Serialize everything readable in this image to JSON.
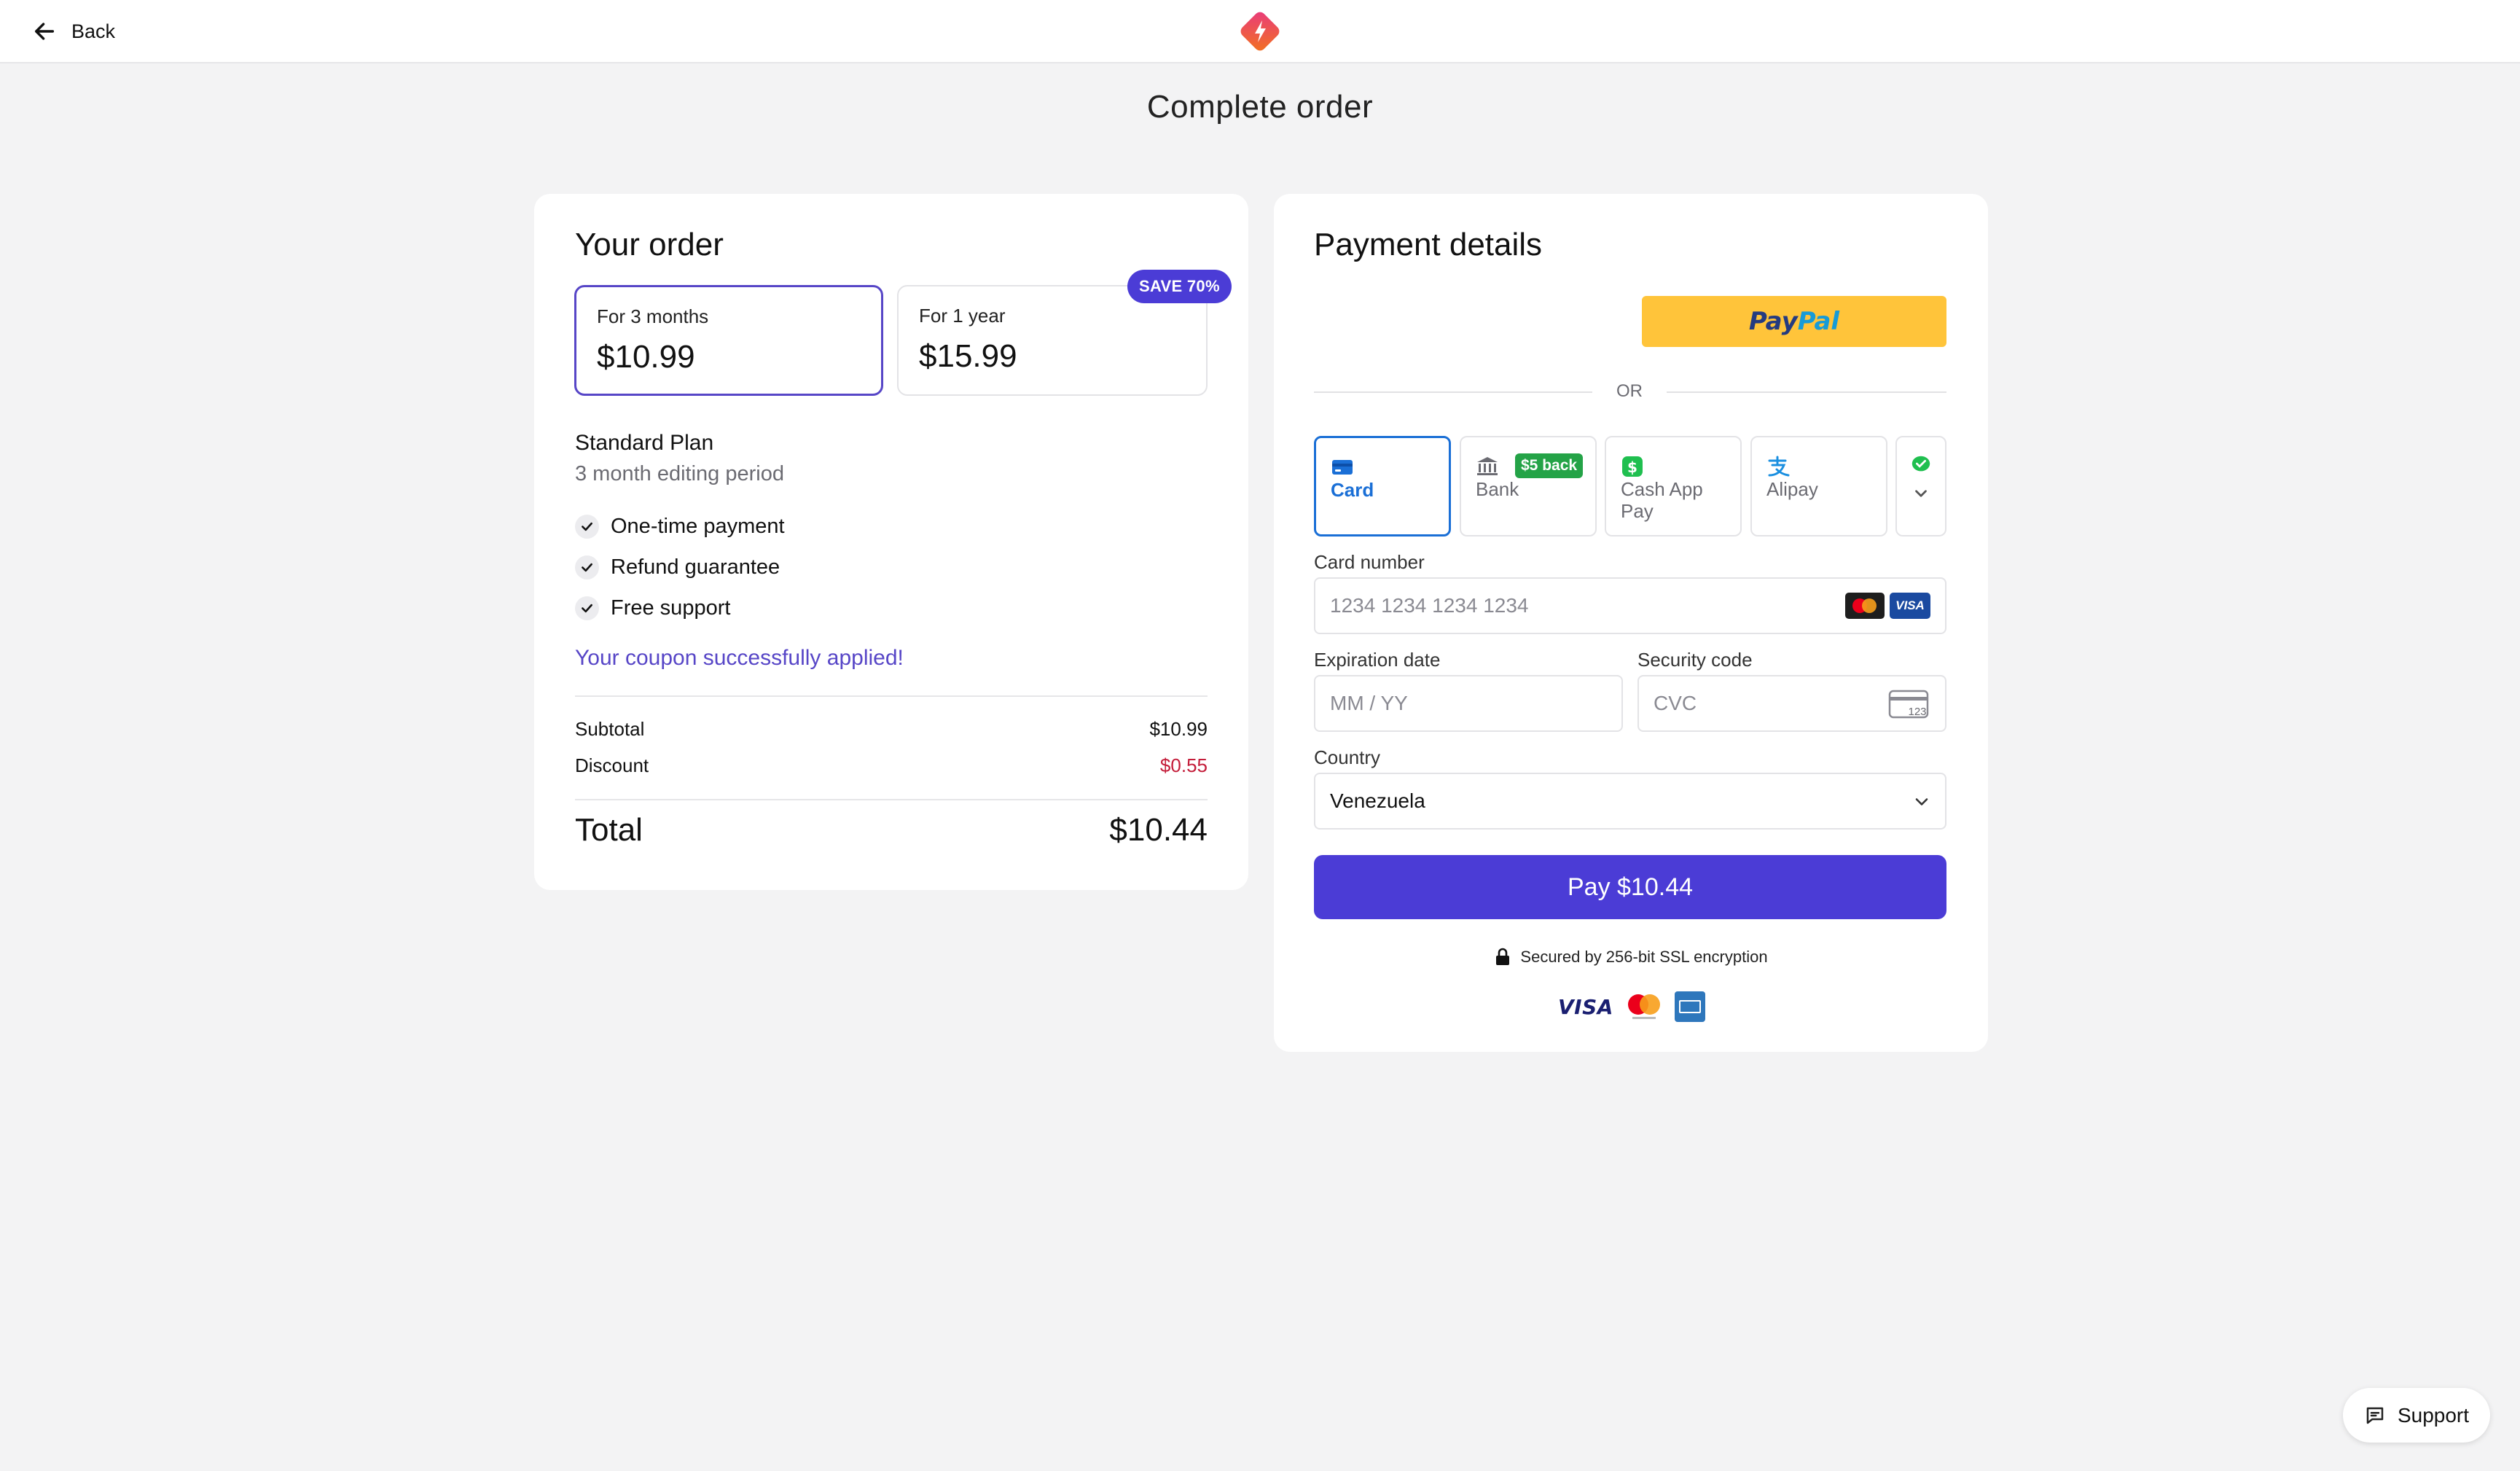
{
  "header": {
    "back_label": "Back",
    "logo_icon": "brand-diamond-logo"
  },
  "page": {
    "title": "Complete order"
  },
  "order": {
    "title": "Your order",
    "plans": [
      {
        "label": "For 3 months",
        "price": "$10.99",
        "selected": true
      },
      {
        "label": "For 1 year",
        "price": "$15.99",
        "selected": false,
        "badge": "SAVE 70%"
      }
    ],
    "plan_name": "Standard Plan",
    "plan_period": "3 month editing period",
    "features": [
      "One-time payment",
      "Refund guarantee",
      "Free support"
    ],
    "coupon_message": "Your coupon successfully applied!",
    "subtotal_label": "Subtotal",
    "subtotal_value": "$10.99",
    "discount_label": "Discount",
    "discount_value": "$0.55",
    "total_label": "Total",
    "total_value": "$10.44"
  },
  "payment": {
    "title": "Payment details",
    "paypal_part1": "Pay",
    "paypal_part2": "Pal",
    "or_label": "OR",
    "methods": [
      {
        "label": "Card",
        "icon": "card-icon",
        "active": true
      },
      {
        "label": "Bank",
        "icon": "bank-icon",
        "badge": "$5 back"
      },
      {
        "label": "Cash App Pay",
        "icon": "cash-app-icon"
      },
      {
        "label": "Alipay",
        "icon": "alipay-icon"
      },
      {
        "label": "",
        "icon": "more-methods-icon"
      }
    ],
    "card_number_label": "Card number",
    "card_number_placeholder": "1234 1234 1234 1234",
    "visa_label": "VISA",
    "expiration_label": "Expiration date",
    "expiration_placeholder": "MM / YY",
    "security_label": "Security code",
    "security_placeholder": "CVC",
    "cvc_icon_text": "123",
    "country_label": "Country",
    "country_value": "Venezuela",
    "pay_button_label": "Pay $10.44",
    "secured_text": "Secured by 256-bit SSL encryption",
    "footer_visa": "VISA"
  },
  "support": {
    "label": "Support"
  },
  "colors": {
    "accent": "#4b3cd6",
    "card_tab_active": "#1a6fd6",
    "discount_red": "#c41d3a",
    "paypal_yellow": "#ffc43a"
  }
}
